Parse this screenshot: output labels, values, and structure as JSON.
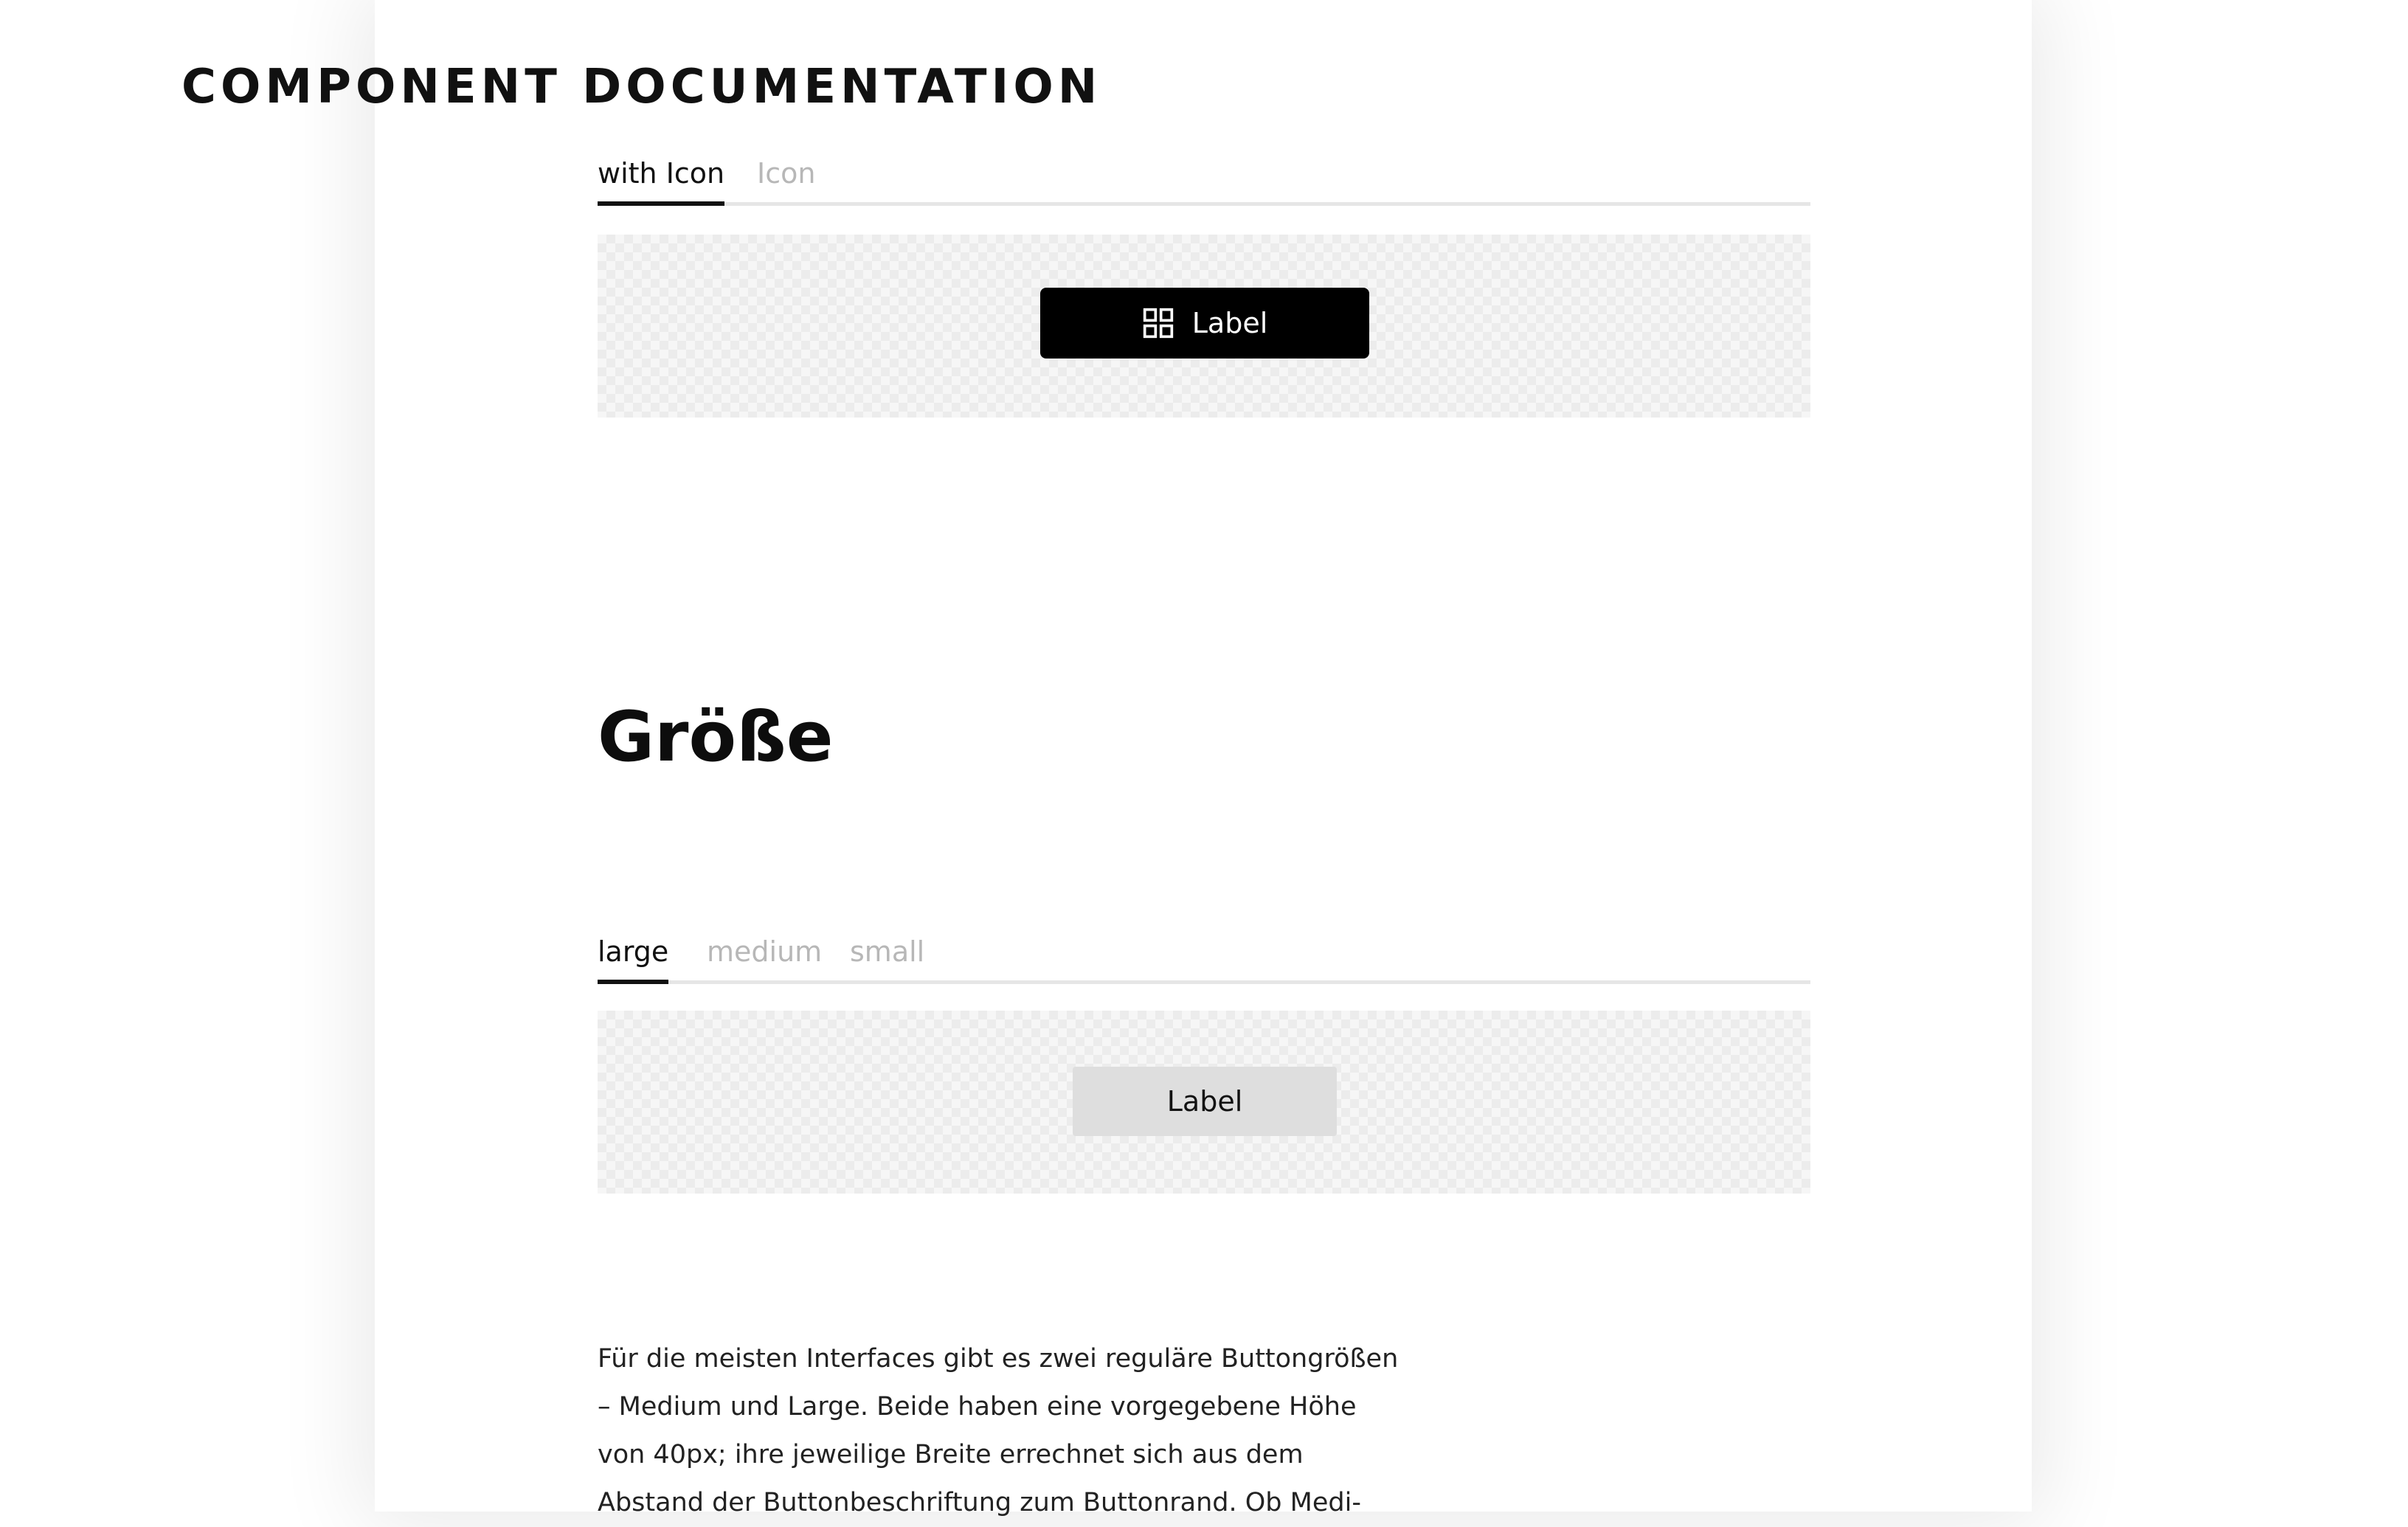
{
  "header": {
    "title": "COMPONENT DOCUMENTATION"
  },
  "variant_demo": {
    "tabs": [
      {
        "label": "with Icon",
        "active": true
      },
      {
        "label": "Icon",
        "active": false
      }
    ],
    "button": {
      "label": "Label",
      "icon": "grid-icon",
      "style": "primary-black"
    }
  },
  "size_section": {
    "heading": "Größe",
    "tabs": [
      {
        "label": "large",
        "active": true
      },
      {
        "label": "medium",
        "active": false
      },
      {
        "label": "small",
        "active": false
      }
    ],
    "button": {
      "label": "Label",
      "style": "secondary-grey"
    },
    "description": "Für die meisten Interfaces gibt es zwei reguläre Buttongrößen – Medium und Large. Beide haben eine vorgegebene Höhe von 40px; ihre jeweilige Breite errechnet sich aus dem Abstand der Buttonbeschriftung zum Buttonrand. Ob Medi-"
  },
  "colors": {
    "primary_button": "#000000",
    "secondary_button": "#dedede",
    "active_tab": "#111111",
    "inactive_tab": "#b7b7b7",
    "preview_checker_light": "#f6f6f6",
    "preview_checker_dark": "#ececec"
  }
}
